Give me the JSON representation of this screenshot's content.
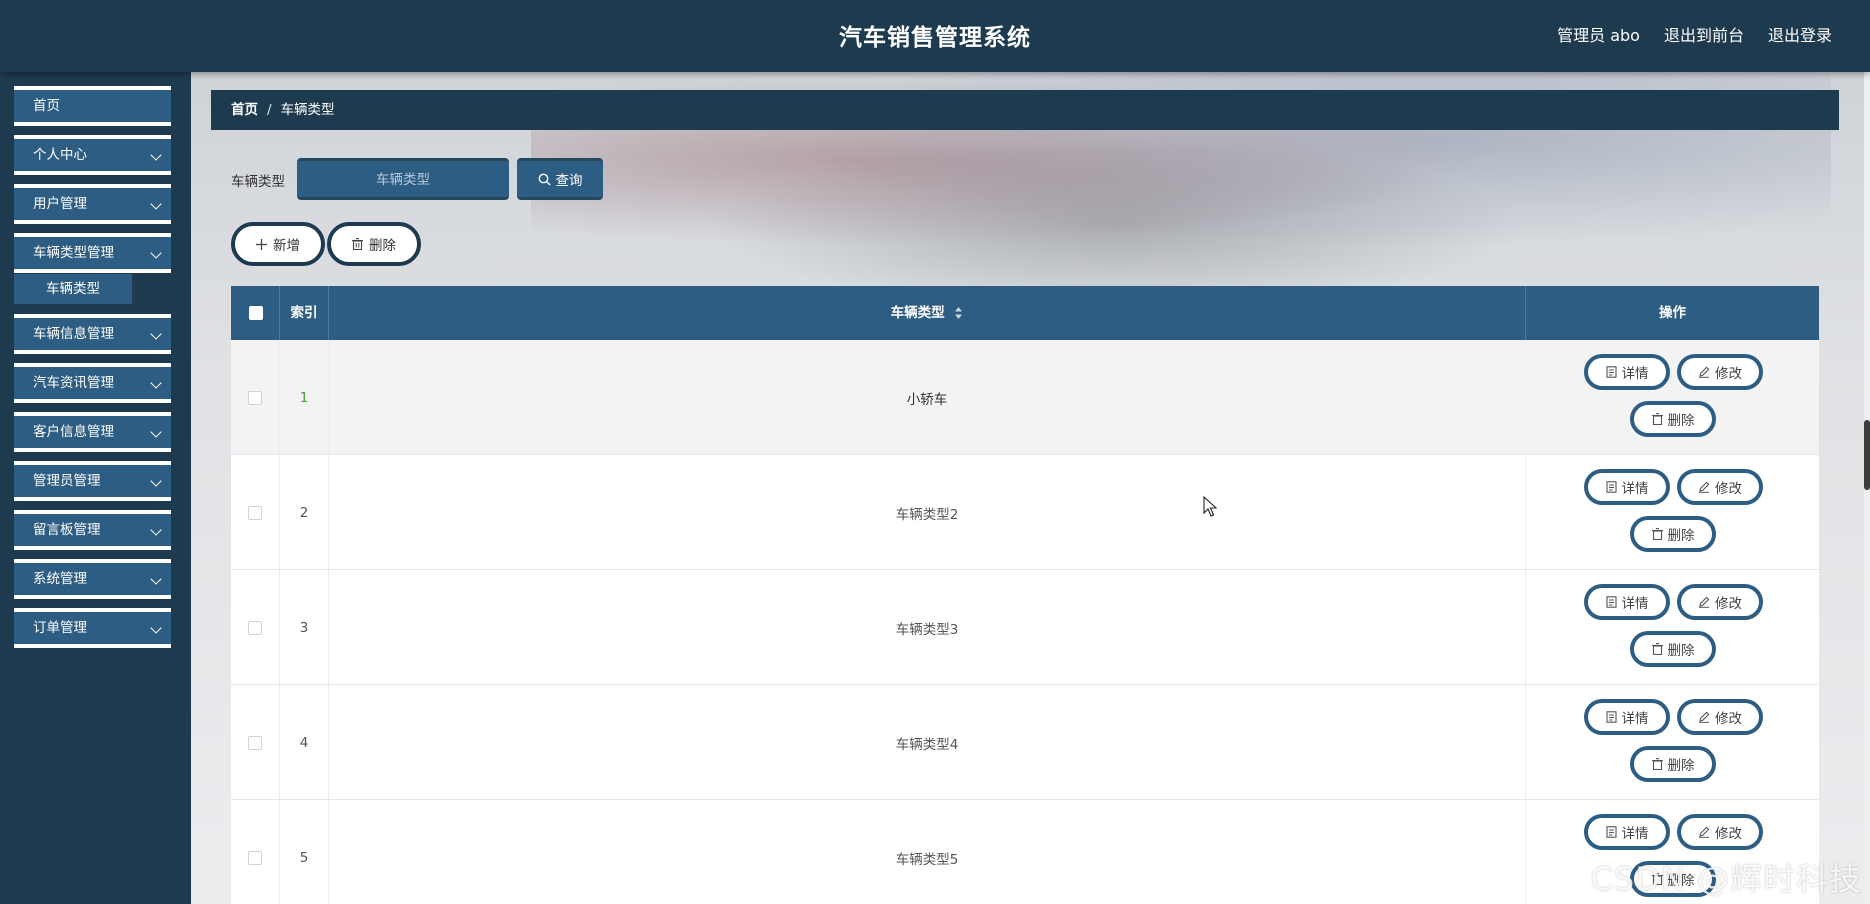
{
  "header": {
    "title": "汽车销售管理系统",
    "admin": "管理员 abo",
    "back_to_front": "退出到前台",
    "logout": "退出登录"
  },
  "sidebar": {
    "items": [
      {
        "label": "首页"
      },
      {
        "label": "个人中心"
      },
      {
        "label": "用户管理"
      },
      {
        "label": "车辆类型管理"
      },
      {
        "label": "车辆信息管理"
      },
      {
        "label": "汽车资讯管理"
      },
      {
        "label": "客户信息管理"
      },
      {
        "label": "管理员管理"
      },
      {
        "label": "留言板管理"
      },
      {
        "label": "系统管理"
      },
      {
        "label": "订单管理"
      }
    ],
    "active_sub": "车辆类型"
  },
  "breadcrumb": {
    "home": "首页",
    "separator": "/",
    "current": "车辆类型"
  },
  "search": {
    "label": "车辆类型",
    "placeholder": "车辆类型",
    "button": "查询"
  },
  "toolbar": {
    "add": "新增",
    "delete": "删除"
  },
  "table": {
    "headers": {
      "index": "索引",
      "type": "车辆类型",
      "actions": "操作"
    },
    "rows": [
      {
        "index": "1",
        "type": "小轿车"
      },
      {
        "index": "2",
        "type": "车辆类型2"
      },
      {
        "index": "3",
        "type": "车辆类型3"
      },
      {
        "index": "4",
        "type": "车辆类型4"
      },
      {
        "index": "5",
        "type": "车辆类型5"
      }
    ],
    "row_actions": {
      "detail": "详情",
      "edit": "修改",
      "delete": "删除"
    }
  },
  "watermark": "CSDN @辉时科技",
  "colors": {
    "header_bg": "#1e3a4f",
    "accent": "#2e5d84",
    "index_highlight": "#4a9a3c"
  }
}
